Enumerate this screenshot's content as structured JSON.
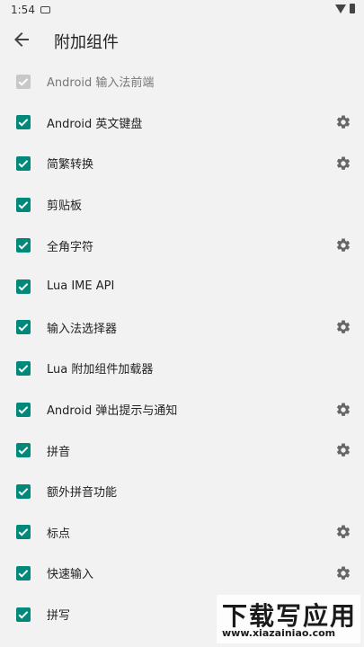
{
  "status_bar": {
    "time": "1:54"
  },
  "app_bar": {
    "title": "附加组件"
  },
  "colors": {
    "accent": "#00897b",
    "disabled": "#c8c8c8"
  },
  "items": [
    {
      "label": "Android 输入法前端",
      "checked": true,
      "disabled": true,
      "settings": false
    },
    {
      "label": "Android 英文键盘",
      "checked": true,
      "disabled": false,
      "settings": true
    },
    {
      "label": "简繁转换",
      "checked": true,
      "disabled": false,
      "settings": true
    },
    {
      "label": "剪贴板",
      "checked": true,
      "disabled": false,
      "settings": false
    },
    {
      "label": "全角字符",
      "checked": true,
      "disabled": false,
      "settings": true
    },
    {
      "label": "Lua IME API",
      "checked": true,
      "disabled": false,
      "settings": false
    },
    {
      "label": "输入法选择器",
      "checked": true,
      "disabled": false,
      "settings": true
    },
    {
      "label": "Lua 附加组件加载器",
      "checked": true,
      "disabled": false,
      "settings": false
    },
    {
      "label": "Android 弹出提示与通知",
      "checked": true,
      "disabled": false,
      "settings": true
    },
    {
      "label": "拼音",
      "checked": true,
      "disabled": false,
      "settings": true
    },
    {
      "label": "额外拼音功能",
      "checked": true,
      "disabled": false,
      "settings": false
    },
    {
      "label": "标点",
      "checked": true,
      "disabled": false,
      "settings": true
    },
    {
      "label": "快速输入",
      "checked": true,
      "disabled": false,
      "settings": true
    },
    {
      "label": "拼写",
      "checked": true,
      "disabled": false,
      "settings": false
    }
  ],
  "watermark": {
    "main": "下载写应用",
    "sub": "www.xiazainiao.com"
  }
}
